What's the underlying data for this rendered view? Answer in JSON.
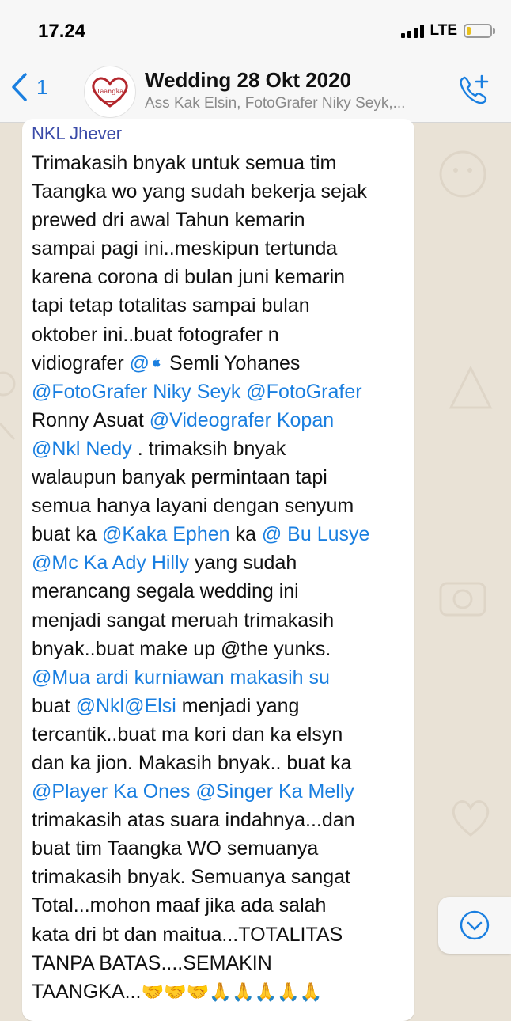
{
  "status": {
    "time": "17.24",
    "network": "LTE"
  },
  "header": {
    "back_count": "1",
    "avatar_text": "Taangka",
    "title": "Wedding 28 Okt 2020",
    "subtitle": "Ass Kak Elsin, FotoGrafer Niky Seyk,..."
  },
  "message": {
    "sender": "NKL Jhever",
    "lines": [
      [
        "Trimakasih bnyak untuk semua tim"
      ],
      [
        "Taangka wo yang sudah bekerja sejak"
      ],
      [
        "prewed dri awal Tahun kemarin"
      ],
      [
        "sampai pagi ini..meskipun tertunda"
      ],
      [
        "karena corona di bulan juni kemarin"
      ],
      [
        "tapi tetap totalitas sampai bulan"
      ],
      [
        "oktober ini..buat fotografer n"
      ],
      [
        "vidiografer ",
        "@",
        "Semli Yohanes"
      ],
      [
        "@FotoGrafer Niky Seyk",
        "  ",
        "@FotoGrafer"
      ],
      [
        "Ronny Asuat",
        " ",
        "@Videografer Kopan"
      ],
      [
        "@Nkl Nedy",
        " . trimaksih bnyak"
      ],
      [
        "walaupun banyak permintaan tapi"
      ],
      [
        "semua hanya layani dengan senyum"
      ],
      [
        "buat ka ",
        "@Kaka Ephen",
        " ka ",
        "@ Bu Lusye"
      ],
      [
        "@Mc Ka Ady Hilly",
        "  yang sudah"
      ],
      [
        "merancang segala wedding ini"
      ],
      [
        "menjadi sangat meruah trimakasih"
      ],
      [
        "bnyak..buat make up @the yunks."
      ],
      [
        "@Mua ardi kurniawan makasih su"
      ],
      [
        "buat ",
        "@Nkl@Elsi",
        " menjadi yang"
      ],
      [
        "tercantik..buat ma kori dan ka elsyn"
      ],
      [
        "dan ka jion. Makasih bnyak.. buat ka"
      ],
      [
        "@Player Ka Ones",
        " ",
        "@Singer Ka Melly"
      ],
      [
        "trimakasih atas suara indahnya...dan"
      ],
      [
        "buat tim Taangka WO semuanya"
      ],
      [
        "trimakasih bnyak. Semuanya sangat"
      ],
      [
        "Total...mohon maaf jika ada salah"
      ],
      [
        "kata dri bt dan maitua...TOTALITAS"
      ],
      [
        "TANPA BATAS....SEMAKIN"
      ],
      [
        "TAANGKA...",
        "🤝🤝🤝🙏🙏🙏🙏🙏"
      ]
    ]
  },
  "colors": {
    "accent": "#1a7fe0",
    "sender": "#3a4aa8",
    "chat_bg": "#e9e2d6"
  },
  "icons": [
    "back-chevron-icon",
    "apple-icon",
    "add-call-icon",
    "chevron-down-icon"
  ]
}
